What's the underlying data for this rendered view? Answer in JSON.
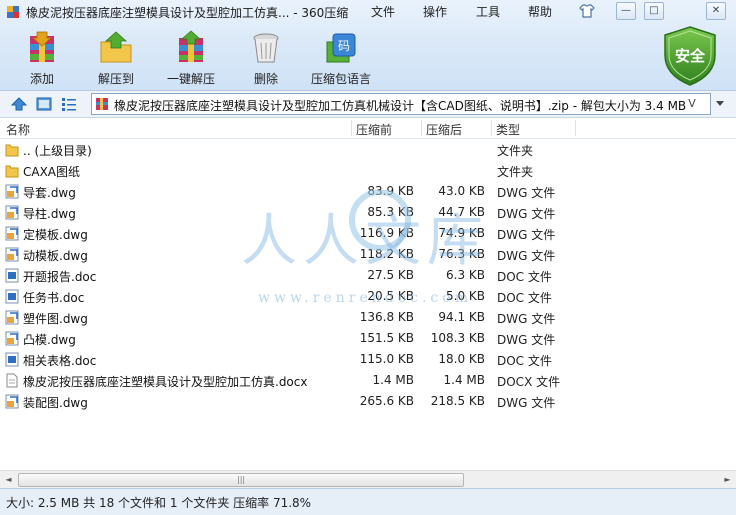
{
  "window": {
    "title": "橡皮泥按压器底座注塑模具设计及型腔加工仿真... - 360压缩",
    "menu": [
      "文件",
      "操作",
      "工具",
      "帮助"
    ],
    "controls": {
      "minimize": "—",
      "maximize": "□",
      "close": "✕"
    }
  },
  "toolbar": {
    "items": [
      {
        "label": "添加",
        "icon": "add-archive-icon"
      },
      {
        "label": "解压到",
        "icon": "extract-to-icon"
      },
      {
        "label": "一键解压",
        "icon": "one-click-extract-icon"
      },
      {
        "label": "删除",
        "icon": "delete-trash-icon"
      },
      {
        "label": "压缩包语言",
        "icon": "archive-language-icon"
      }
    ],
    "badge": {
      "label": "安全",
      "icon": "security-shield-icon",
      "color": "#4a9e2e"
    },
    "language_glyph": "码"
  },
  "navbar": {
    "path": "橡皮泥按压器底座注塑模具设计及型腔加工仿真机械设计【含CAD图纸、说明书】.zip - 解包大小为 3.4 MB",
    "v_label": "V"
  },
  "columns": {
    "name": "名称",
    "compressed": "压缩前",
    "packed": "压缩后",
    "type": "类型"
  },
  "files": [
    {
      "name": ".. (上级目录)",
      "size": "",
      "packed": "",
      "type": "文件夹",
      "icon": "folder"
    },
    {
      "name": "CAXA图纸",
      "size": "",
      "packed": "",
      "type": "文件夹",
      "icon": "folder"
    },
    {
      "name": "导套.dwg",
      "size": "83.9 KB",
      "packed": "43.0 KB",
      "type": "DWG 文件",
      "icon": "dwg"
    },
    {
      "name": "导柱.dwg",
      "size": "85.3 KB",
      "packed": "44.7 KB",
      "type": "DWG 文件",
      "icon": "dwg"
    },
    {
      "name": "定模板.dwg",
      "size": "116.9 KB",
      "packed": "74.9 KB",
      "type": "DWG 文件",
      "icon": "dwg"
    },
    {
      "name": "动模板.dwg",
      "size": "118.2 KB",
      "packed": "76.3 KB",
      "type": "DWG 文件",
      "icon": "dwg"
    },
    {
      "name": "开题报告.doc",
      "size": "27.5 KB",
      "packed": "6.3 KB",
      "type": "DOC 文件",
      "icon": "doc"
    },
    {
      "name": "任务书.doc",
      "size": "20.5 KB",
      "packed": "5.0 KB",
      "type": "DOC 文件",
      "icon": "doc"
    },
    {
      "name": "塑件图.dwg",
      "size": "136.8 KB",
      "packed": "94.1 KB",
      "type": "DWG 文件",
      "icon": "dwg"
    },
    {
      "name": "凸模.dwg",
      "size": "151.5 KB",
      "packed": "108.3 KB",
      "type": "DWG 文件",
      "icon": "dwg"
    },
    {
      "name": "相关表格.doc",
      "size": "115.0 KB",
      "packed": "18.0 KB",
      "type": "DOC 文件",
      "icon": "doc"
    },
    {
      "name": "橡皮泥按压器底座注塑模具设计及型腔加工仿真.docx",
      "size": "1.4 MB",
      "packed": "1.4 MB",
      "type": "DOCX 文件",
      "icon": "docx"
    },
    {
      "name": "装配图.dwg",
      "size": "265.6 KB",
      "packed": "218.5 KB",
      "type": "DWG 文件",
      "icon": "dwg"
    }
  ],
  "watermark": {
    "main": "人人文库",
    "url": "www.renrendoc.com"
  },
  "scrollbar": {
    "left": "◄",
    "right": "►",
    "grip": "|||"
  },
  "status": "大小: 2.5 MB 共 18 个文件和 1 个文件夹 压缩率 71.8%"
}
